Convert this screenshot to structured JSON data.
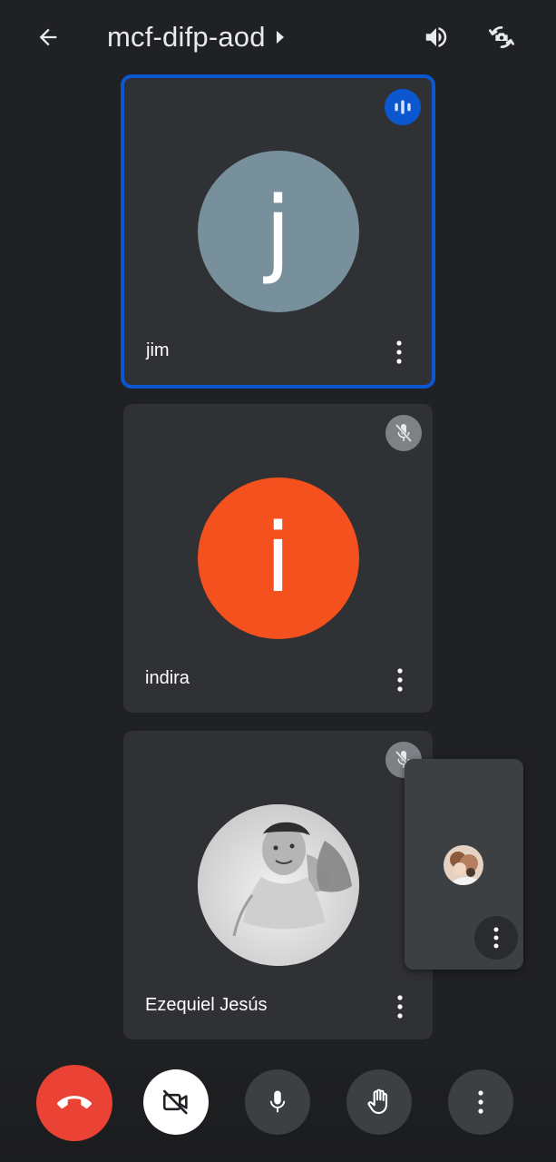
{
  "meeting": {
    "code": "mcf-difp-aod"
  },
  "colors": {
    "background": "#202124",
    "tile": "#303134",
    "active_border": "#0b57d0",
    "end_call": "#ea4335",
    "avatar_jim": "#78909c",
    "avatar_indira": "#f4511e"
  },
  "participants": [
    {
      "name": "jim",
      "initial": "j",
      "state": "speaking",
      "avatar_color": "#78909c"
    },
    {
      "name": "indira",
      "initial": "i",
      "state": "muted",
      "avatar_color": "#f4511e"
    },
    {
      "name": "Ezequiel Jesús",
      "initial": "",
      "state": "muted",
      "avatar_type": "photo"
    }
  ],
  "icons": {
    "back": "arrow-left-icon",
    "title_caret": "caret-right-icon",
    "audio_output": "speaker-icon",
    "switch_camera": "camera-switch-icon",
    "speaking": "audio-bars-icon",
    "muted": "mic-off-icon",
    "more": "more-vert-icon",
    "end_call": "call-end-icon",
    "camera_off": "videocam-off-icon",
    "mic": "mic-icon",
    "raise_hand": "hand-icon"
  }
}
